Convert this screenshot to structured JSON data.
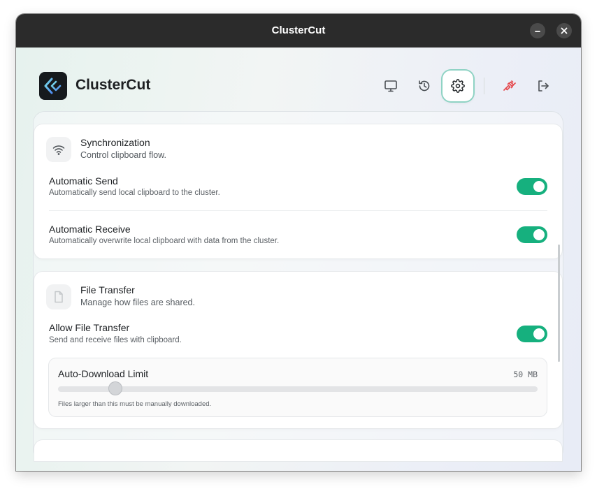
{
  "window": {
    "title": "ClusterCut",
    "minimize_icon": "minimize-icon",
    "close_icon": "close-icon"
  },
  "header": {
    "app_name": "ClusterCut",
    "logo_icon": "clustercut-logo",
    "nav": [
      {
        "name": "devices",
        "icon": "monitor-icon"
      },
      {
        "name": "history",
        "icon": "history-icon"
      },
      {
        "name": "settings",
        "icon": "gear-icon",
        "active": true
      },
      {
        "name": "disconnect",
        "icon": "plug-disconnect-icon"
      },
      {
        "name": "logout",
        "icon": "logout-icon"
      }
    ]
  },
  "sync": {
    "title": "Synchronization",
    "subtitle": "Control clipboard flow.",
    "icon": "wifi-icon",
    "rows": [
      {
        "label": "Automatic Send",
        "desc": "Automatically send local clipboard to the cluster.",
        "enabled": true
      },
      {
        "label": "Automatic Receive",
        "desc": "Automatically overwrite local clipboard with data from the cluster.",
        "enabled": true
      }
    ]
  },
  "file_transfer": {
    "title": "File Transfer",
    "subtitle": "Manage how files are shared.",
    "icon": "file-icon",
    "allow": {
      "label": "Allow File Transfer",
      "desc": "Send and receive files with clipboard.",
      "enabled": true
    },
    "limit": {
      "label": "Auto-Download Limit",
      "value": "50 MB",
      "fraction": 0.11,
      "note": "Files larger than this must be manually downloaded."
    }
  },
  "colors": {
    "accent": "#16b07e",
    "active_ring": "#8fd3c4",
    "disconnect_red": "#e5484d",
    "titlebar": "#2b2b2b"
  }
}
